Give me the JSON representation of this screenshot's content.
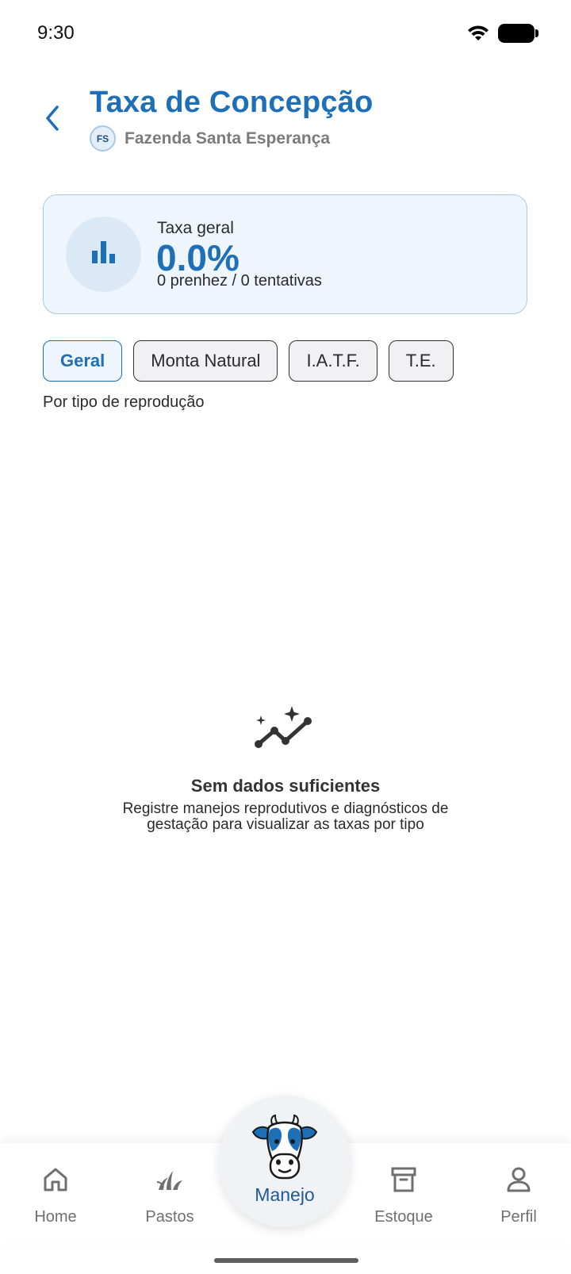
{
  "status_bar": {
    "time": "9:30",
    "wifi_icon": "wifi-icon",
    "battery_icon": "battery-icon"
  },
  "header": {
    "back_icon": "chevron-left-icon",
    "title": "Taxa de Concepção",
    "farm_initials": "FS",
    "farm_name": "Fazenda Santa Esperança"
  },
  "summary": {
    "icon": "bar-chart-icon",
    "label": "Taxa geral",
    "value": "0.0%",
    "detail": "0 prenhez / 0 tentativas"
  },
  "filters": {
    "chips": [
      {
        "label": "Geral",
        "selected": true
      },
      {
        "label": "Monta Natural",
        "selected": false
      },
      {
        "label": "I.A.T.F.",
        "selected": false
      },
      {
        "label": "T.E.",
        "selected": false
      }
    ],
    "section_label": "Por tipo de reprodução"
  },
  "empty_state": {
    "icon": "sparkle-trend-icon",
    "title": "Sem dados suficientes",
    "description": "Registre manejos reprodutivos e diagnósticos de gestação para visualizar as taxas por tipo"
  },
  "bottom_nav": {
    "items": [
      {
        "label": "Home",
        "icon": "home-icon"
      },
      {
        "label": "Pastos",
        "icon": "grass-icon"
      },
      {
        "label": "Manejo",
        "icon": "cow-icon",
        "active": true
      },
      {
        "label": "Estoque",
        "icon": "archive-box-icon"
      },
      {
        "label": "Perfil",
        "icon": "user-icon"
      }
    ]
  },
  "colors": {
    "primary": "#1d6fb8",
    "card_background": "#eef5fc",
    "card_border": "#a9cbe9",
    "muted_text": "#7b7b7b"
  }
}
